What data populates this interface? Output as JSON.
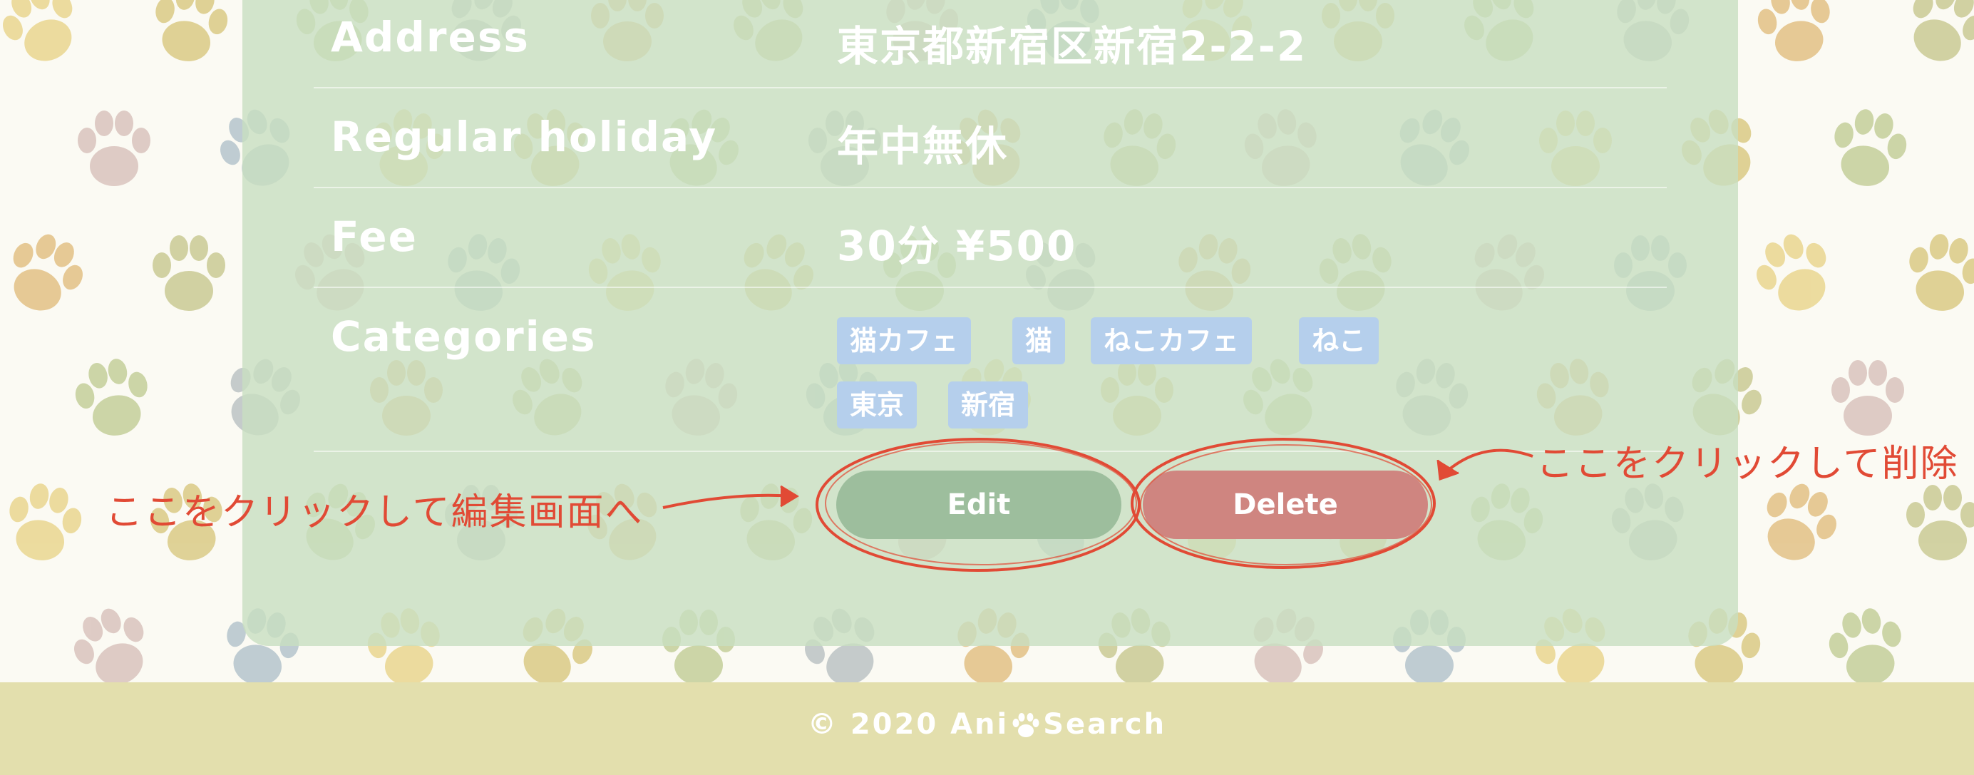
{
  "details": [
    {
      "label": "Address",
      "value": "東京都新宿区新宿2-2-2"
    },
    {
      "label": "Regular holiday",
      "value": "年中無休"
    },
    {
      "label": "Fee",
      "value": "30分 ¥500"
    },
    {
      "label": "Categories"
    }
  ],
  "categories": [
    "猫カフェ",
    "猫",
    "ねこカフェ",
    "ねこ",
    "東京",
    "新宿"
  ],
  "actions": {
    "edit_label": "Edit",
    "delete_label": "Delete"
  },
  "annotations": {
    "left": "ここをクリックして編集画面へ",
    "right": "ここをクリックして削除"
  },
  "footer": {
    "copyright": "© 2020 Ani",
    "brand_suffix": "Search",
    "logo_icon": "paw-icon"
  },
  "colors": {
    "card_bg": "#c8dec0",
    "edit_button": "#9dbe9d",
    "delete_button": "#cf8580",
    "tag_bg": "#b5cfec",
    "annotation": "#e14a35",
    "footer_bg": "#e3dfad"
  }
}
